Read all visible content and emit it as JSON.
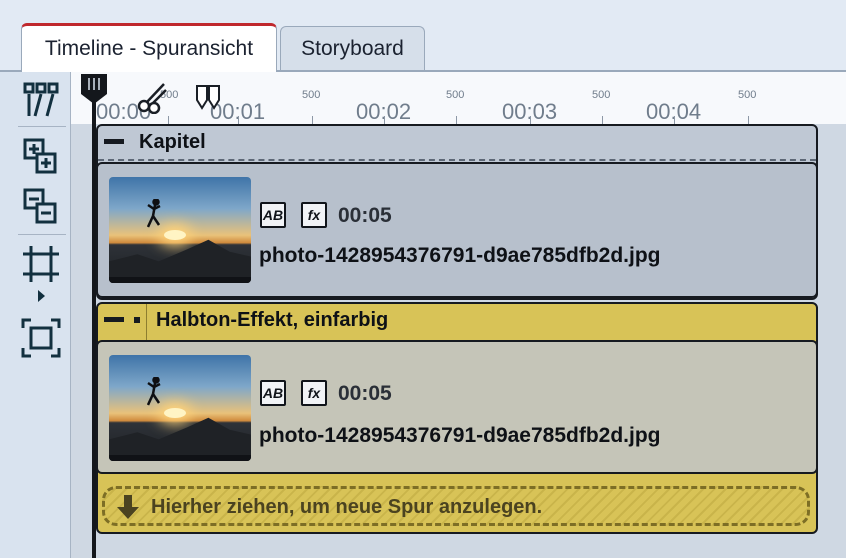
{
  "tabs": [
    {
      "label": "Timeline - Spuransicht",
      "active": true
    },
    {
      "label": "Storyboard",
      "active": false
    }
  ],
  "ruler": {
    "times": [
      "00:00",
      "00:01",
      "00:02",
      "00:03",
      "00:04"
    ],
    "sub_marks": [
      "500",
      "500",
      "500",
      "500",
      "500"
    ]
  },
  "toolbar": {
    "icons": [
      "timeline-tracks-icon",
      "add-track-icon",
      "remove-track-icon",
      "fit-track-icon",
      "fullscreen-frame-icon"
    ]
  },
  "chapter_track": {
    "title": "Kapitel",
    "clip": {
      "duration": "00:05",
      "filename": "photo-1428954376791-d9ae785dfb2d.jpg"
    }
  },
  "effect_track": {
    "title": "Halbton-Effekt, einfarbig",
    "clip": {
      "duration": "00:05",
      "filename": "photo-1428954376791-d9ae785dfb2d.jpg"
    },
    "dropzone_text": "Hierher ziehen, um neue Spur anzulegen."
  },
  "colors": {
    "accent_tab": "#c0282d",
    "effect_track": "#d8c357",
    "chapter_track": "#bfc8d4"
  }
}
